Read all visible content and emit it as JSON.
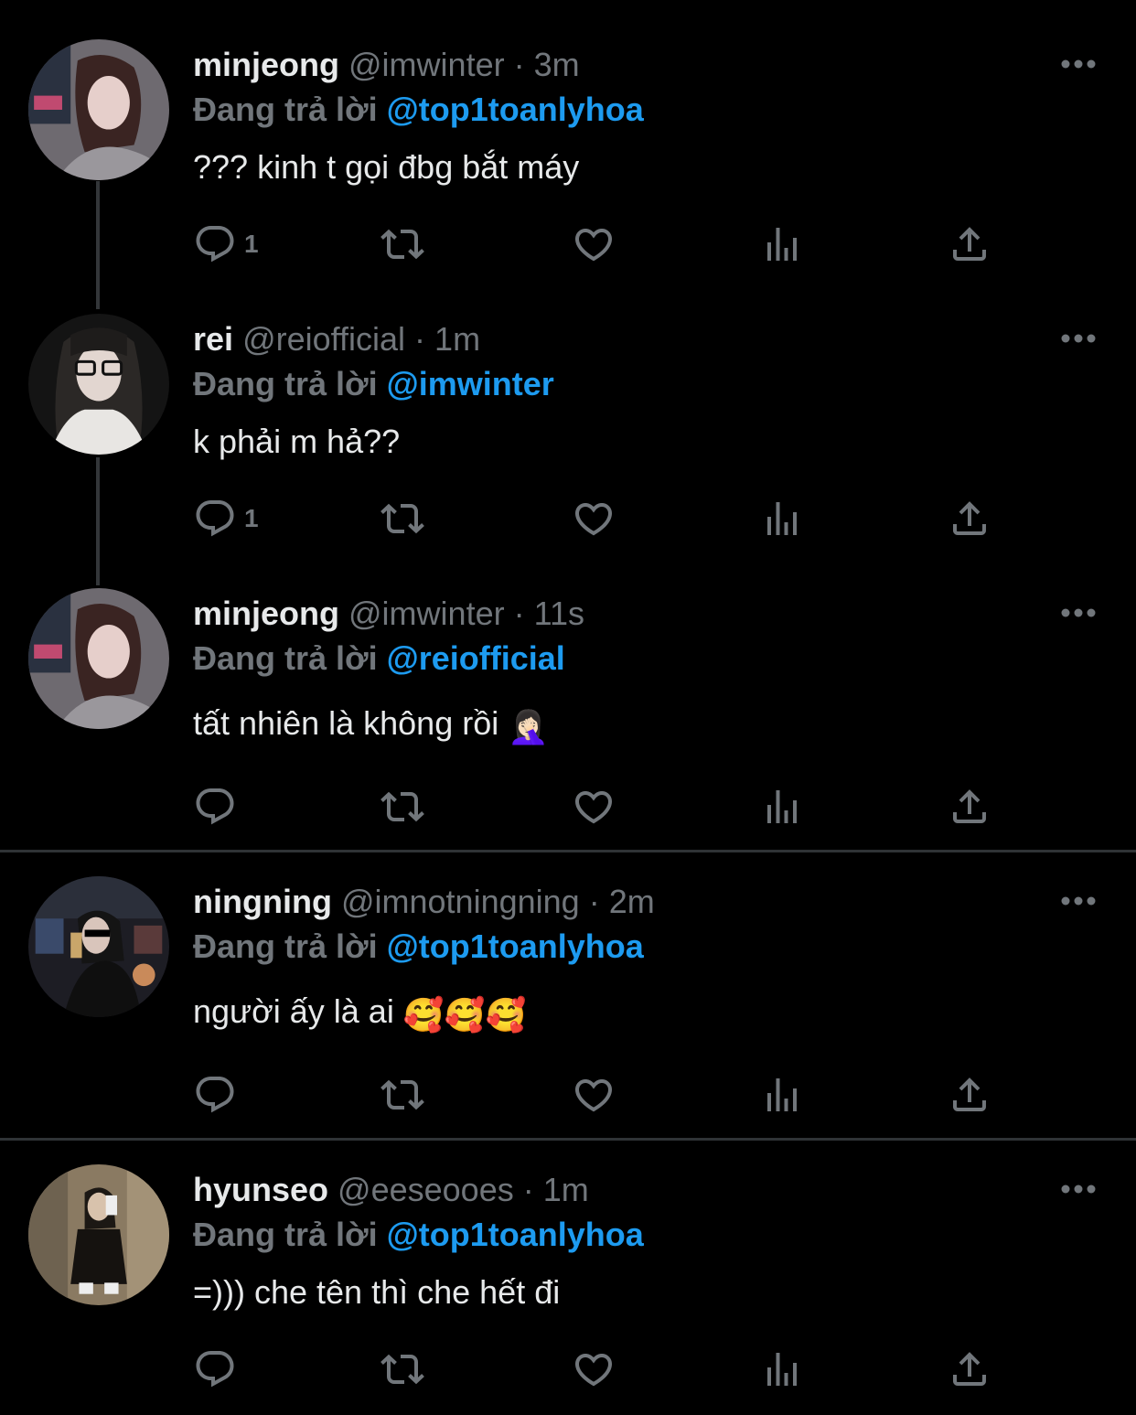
{
  "tweets": [
    {
      "name": "minjeong",
      "handle": "@imwinter",
      "time": "3m",
      "replying_label": "Đang trả lời",
      "replying_to": "@top1toanlyhoa",
      "text": "??? kinh t gọi đbg bắt máy",
      "reply_count": "1",
      "avatar_palette": "pale"
    },
    {
      "name": "rei",
      "handle": "@reiofficial",
      "time": "1m",
      "replying_label": "Đang trả lời",
      "replying_to": "@imwinter",
      "text": "k phải m hả??",
      "reply_count": "1",
      "avatar_palette": "dark"
    },
    {
      "name": "minjeong",
      "handle": "@imwinter",
      "time": "11s",
      "replying_label": "Đang trả lời",
      "replying_to": "@reiofficial",
      "text": "tất nhiên là không rồi",
      "emoji": "🤦🏻‍♀️",
      "reply_count": "",
      "avatar_palette": "pale"
    },
    {
      "name": "ningning",
      "handle": "@imnotningning",
      "time": "2m",
      "replying_label": "Đang trả lời",
      "replying_to": "@top1toanlyhoa",
      "text": "người ấy là ai",
      "emoji": "🥰🥰🥰",
      "reply_count": "",
      "avatar_palette": "night"
    },
    {
      "name": "hyunseo",
      "handle": "@eeseooes",
      "time": "1m",
      "replying_label": "Đang trả lời",
      "replying_to": "@top1toanlyhoa",
      "text": "=))) che tên thì che hết đi",
      "reply_count": "",
      "avatar_palette": "warm"
    }
  ],
  "colors": {
    "background": "#000000",
    "muted": "#71767b",
    "mention": "#1d9bf0",
    "divider": "#2f3336"
  },
  "icons": [
    "reply-icon",
    "retweet-icon",
    "like-icon",
    "analytics-icon",
    "share-icon",
    "more-icon"
  ]
}
